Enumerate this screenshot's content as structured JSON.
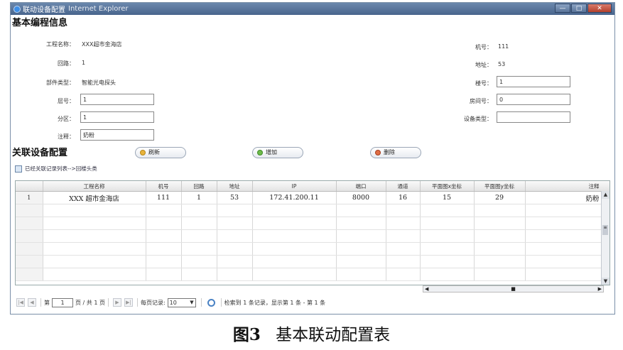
{
  "window": {
    "title": "联动设备配置",
    "subtitle": "Internet Explorer",
    "controls": [
      "—",
      "□",
      "✕"
    ]
  },
  "basic": {
    "section_title": "基本编程信息",
    "left_fields": [
      {
        "label": "工程名称：",
        "value": "XXX超市金海店",
        "type": "text"
      },
      {
        "label": "回路：",
        "value": "1",
        "type": "text"
      },
      {
        "label": "部件类型：",
        "value": "智能光电探头",
        "type": "text"
      },
      {
        "label": "层号：",
        "value": "1",
        "type": "input"
      },
      {
        "label": "分区：",
        "value": "1",
        "type": "input"
      },
      {
        "label": "注释：",
        "value": "奶粉",
        "type": "input"
      }
    ],
    "right_fields": [
      {
        "label": "机号：",
        "value": "111",
        "type": "text"
      },
      {
        "label": "地址：",
        "value": "53",
        "type": "text"
      },
      {
        "label": "楼号：",
        "value": "1",
        "type": "input"
      },
      {
        "label": "房间号：",
        "value": "0",
        "type": "input"
      },
      {
        "label": "设备类型：",
        "value": "",
        "type": "input"
      }
    ]
  },
  "linked": {
    "section_title": "关联设备配置",
    "buttons": {
      "refresh": "刷新",
      "add": "增加",
      "delete": "删除"
    },
    "breadcrumb": "已经关联记录列表-->回楼头类"
  },
  "table": {
    "columns": [
      "",
      "工程名称",
      "机号",
      "回路",
      "地址",
      "IP",
      "端口",
      "通道",
      "平面图x坐标",
      "平面图y坐标",
      "注释"
    ],
    "rows": [
      [
        "1",
        "XXX 超市金海店",
        "111",
        "1",
        "53",
        "172.41.200.11",
        "8000",
        "16",
        "15",
        "29",
        "奶粉"
      ]
    ]
  },
  "pager": {
    "page_label": "第",
    "page_value": "1",
    "of_label": "页 / 共 1 页",
    "per_page_label": "每页记录:",
    "per_page_value": "10",
    "summary": "检索到 1 条记录，显示第 1 条 - 第 1 条"
  },
  "caption": {
    "figure": "图3",
    "text": "基本联动配置表"
  }
}
